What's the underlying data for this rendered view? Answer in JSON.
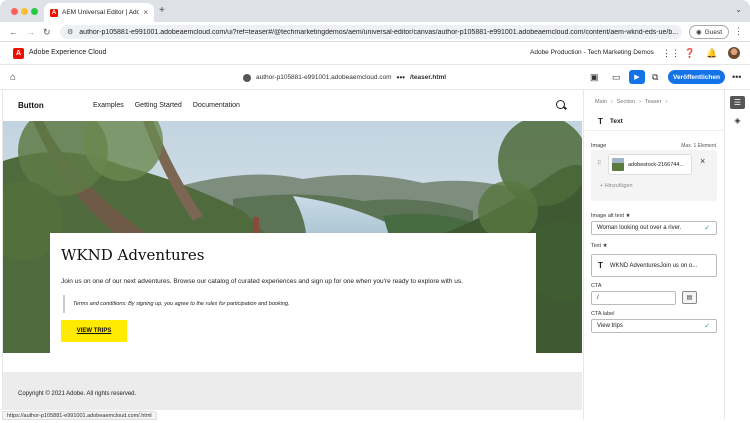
{
  "browser": {
    "tab_title": "AEM Universal Editor | Adobe",
    "tab_close": "×",
    "new_tab": "+",
    "tab_menu": "⌄",
    "url": "author-p105881-e991001.adobeaemcloud.com/ui?ref=teaser#/@techmarketingdemos/aem/universal-editor/canvas/author-p105881-e991001.adobeaemcloud.com/content/aem-wknd-eds-ue/b...",
    "guest_label": "Guest",
    "status_url": "https://author-p105881-e991001.adobeaemcloud.com/.html"
  },
  "aec": {
    "logo_letter": "A",
    "title": "Adobe Experience Cloud",
    "org": "Adobe Production - Tech Marketing Demos"
  },
  "editor": {
    "host": "author-p105881-e991001.adobeaemcloud.com",
    "ellipsis": "•••",
    "page": "/teaser.html",
    "publish_label": "Veröffentlichen"
  },
  "site": {
    "brand": "Button",
    "nav": [
      "Examples",
      "Getting Started",
      "Documentation"
    ],
    "teaser": {
      "title": "WKND Adventures",
      "text": "Join us on one of our next adventures. Browse our catalog of curated experiences and sign up for one when you're ready to explore with us.",
      "terms": "Terms and conditions: By signing up, you agree to the rules for participation and booking.",
      "cta": "VIEW TRIPS"
    },
    "copyright": "Copyright © 2021 Adobe. All rights reserved."
  },
  "panel": {
    "breadcrumb": [
      "Main",
      "›",
      "Section",
      "›",
      "Teaser",
      "›"
    ],
    "block_icon": "T",
    "block_label": "Text",
    "image_label": "Image",
    "image_max": "Max. 1 Element",
    "image_file": "adobestock-2166744...",
    "image_remove": "×",
    "add_label": "+ Hinzufügen",
    "alt_label": "Image alt text ★",
    "alt_value": "Woman looking out over a river.",
    "text_label": "Text ★",
    "text_icon": "T",
    "text_value": "WKND AdventuresJoin us on o...",
    "cta_label": "CTA",
    "cta_value": "/",
    "cta_picker": "▤",
    "ctalabel_label": "CTA label",
    "ctalabel_value": "View trips",
    "check": "✓"
  },
  "colors": {
    "accent": "#1473e6",
    "adobe_red": "#eb1000",
    "cta_yellow": "#ffea00"
  }
}
